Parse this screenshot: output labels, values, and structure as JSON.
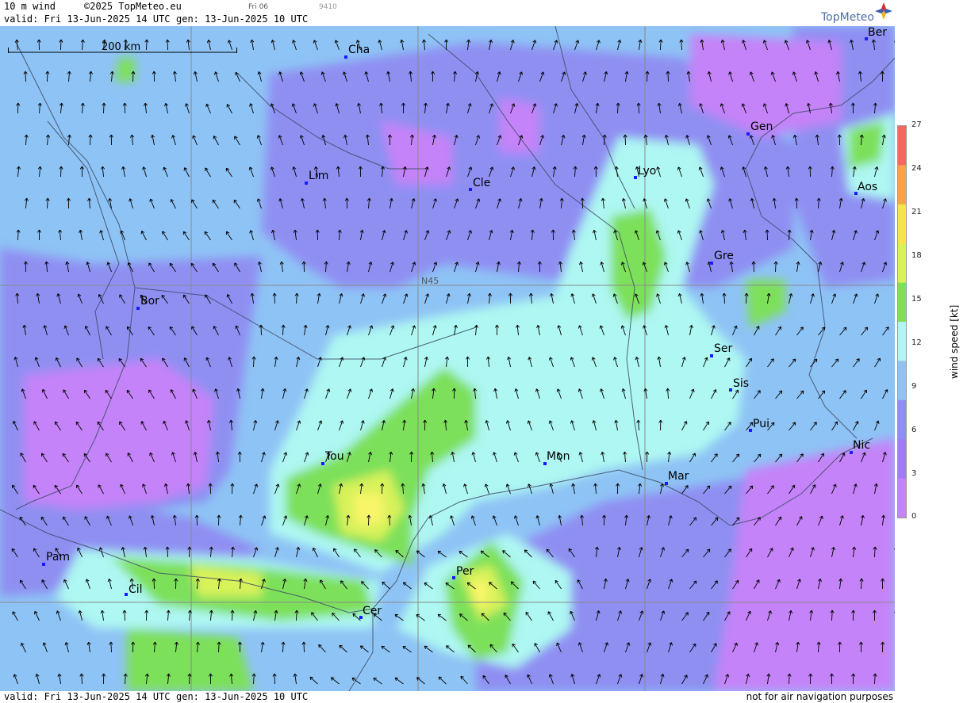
{
  "header": {
    "product": "10 m wind",
    "copyright": "©2025 TopMeteo.eu",
    "frame_day": "Fri 06",
    "frame_num": "9410",
    "valid": "valid:  Fri  13-Jun-2025  14 UTC",
    "generated": "gen: 13-Jun-2025 10 UTC"
  },
  "brand": {
    "name": "TopMeteo"
  },
  "scale_bar": {
    "label": "200 km"
  },
  "lat_label": "N45",
  "cities": [
    {
      "name": "Cha"
    },
    {
      "name": "Lim"
    },
    {
      "name": "Cle"
    },
    {
      "name": "Lyo"
    },
    {
      "name": "Gen"
    },
    {
      "name": "Ber"
    },
    {
      "name": "Aos"
    },
    {
      "name": "Gre"
    },
    {
      "name": "Bor"
    },
    {
      "name": "Ser"
    },
    {
      "name": "Sis"
    },
    {
      "name": "Pui"
    },
    {
      "name": "Tou"
    },
    {
      "name": "Mon"
    },
    {
      "name": "Mar"
    },
    {
      "name": "Nic"
    },
    {
      "name": "Pam"
    },
    {
      "name": "Cil"
    },
    {
      "name": "Per"
    },
    {
      "name": "Cer"
    }
  ],
  "colorbar": {
    "title": "wind  speed  [kt]",
    "ticks": [
      "27",
      "24",
      "21",
      "18",
      "15",
      "12",
      "9",
      "6",
      "3",
      "0"
    ],
    "colors": [
      "#f26a5e",
      "#f8a24a",
      "#f9e24f",
      "#d8f25a",
      "#7de05a",
      "#aef7f2",
      "#8ec3f5",
      "#8f8ff2",
      "#a17cf2",
      "#c483f8"
    ]
  },
  "footer": {
    "valid": "valid:  Fri  13-Jun-2025  14 UTC",
    "generated": "gen: 13-Jun-2025 10 UTC",
    "disclaimer": "not for air navigation purposes"
  },
  "colors": {
    "calm": "#c483f8",
    "light": "#8f8ff2",
    "moderate": "#8ec3f5",
    "fresh": "#aef7f2",
    "strong": "#7de05a",
    "very_strong": "#d8f25a",
    "max": "#f9f56b"
  }
}
